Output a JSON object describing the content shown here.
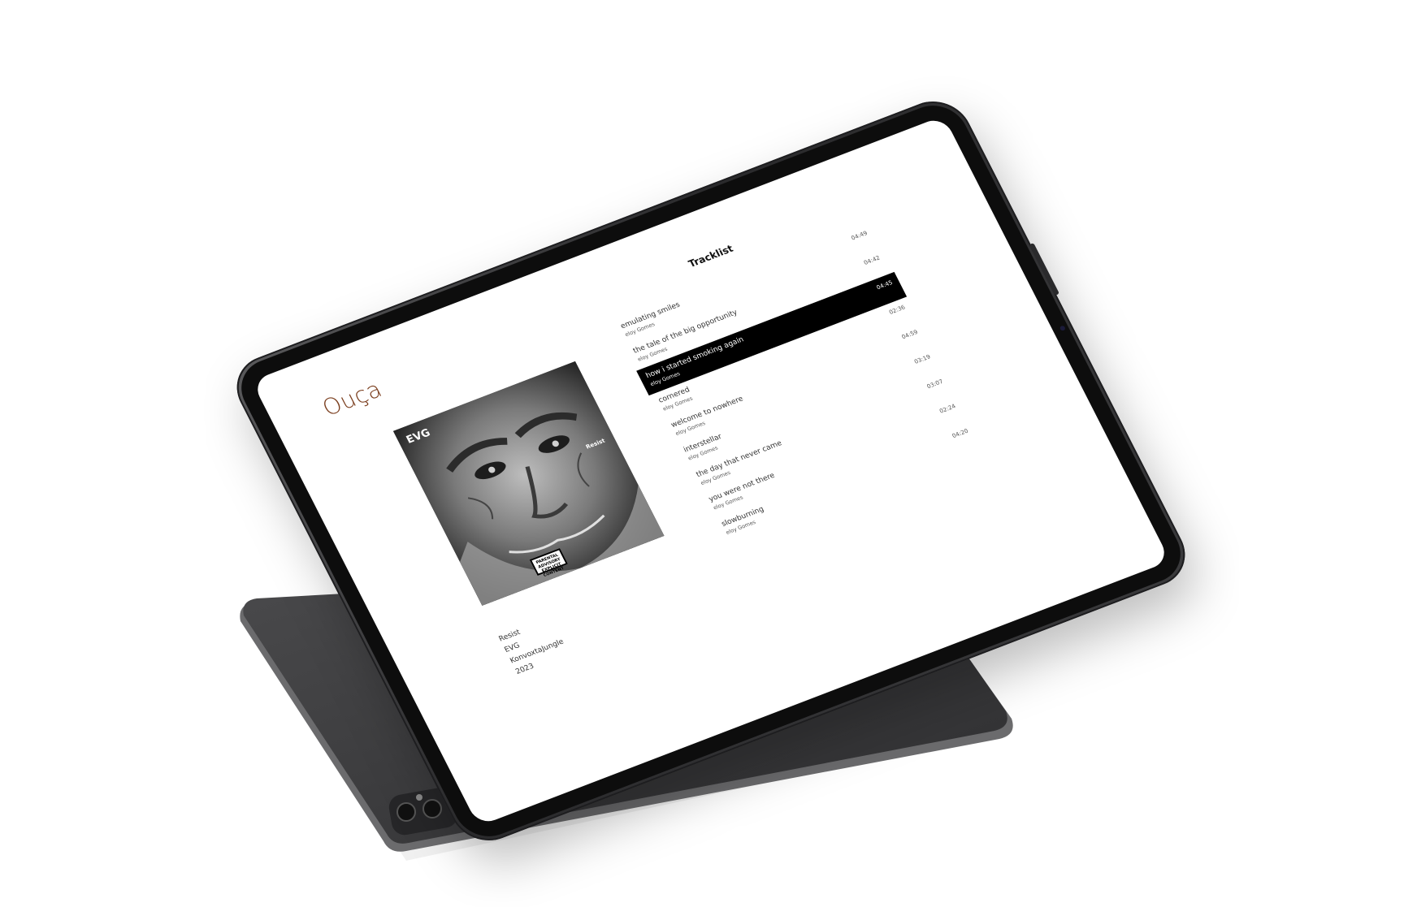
{
  "app": {
    "title": "Ouça"
  },
  "album": {
    "art_logo": "EVG",
    "art_caption": "Resist",
    "art_advisory": "PARENTAL ADVISORY EXPLICIT CONTENT",
    "title": "Resist",
    "artist": "EVG",
    "label": "KonvoxtaJungle",
    "year": "2023"
  },
  "tracklist": {
    "heading": "Tracklist",
    "active_index": 2,
    "tracks": [
      {
        "title": "emulating smiles",
        "artist": "eloy Gomes",
        "duration": "04:49"
      },
      {
        "title": "the tale of the big opportunity",
        "artist": "eloy Gomes",
        "duration": "04:42"
      },
      {
        "title": "how i started smoking again",
        "artist": "eloy Gomes",
        "duration": "04:45"
      },
      {
        "title": "cornered",
        "artist": "eloy Gomes",
        "duration": "02:36"
      },
      {
        "title": "welcome to nowhere",
        "artist": "eloy Gomes",
        "duration": "04:59"
      },
      {
        "title": "interstellar",
        "artist": "eloy Gomes",
        "duration": "03:19"
      },
      {
        "title": "the day that never came",
        "artist": "eloy Gomes",
        "duration": "03:07"
      },
      {
        "title": "you were not there",
        "artist": "eloy Gomes",
        "duration": "02:24"
      },
      {
        "title": "slowburning",
        "artist": "eloy Gomes",
        "duration": "04:20"
      }
    ]
  },
  "colors": {
    "title_accent": "#7a3d1d",
    "active_row": "#000000",
    "device_body": "#3a3a3c"
  }
}
